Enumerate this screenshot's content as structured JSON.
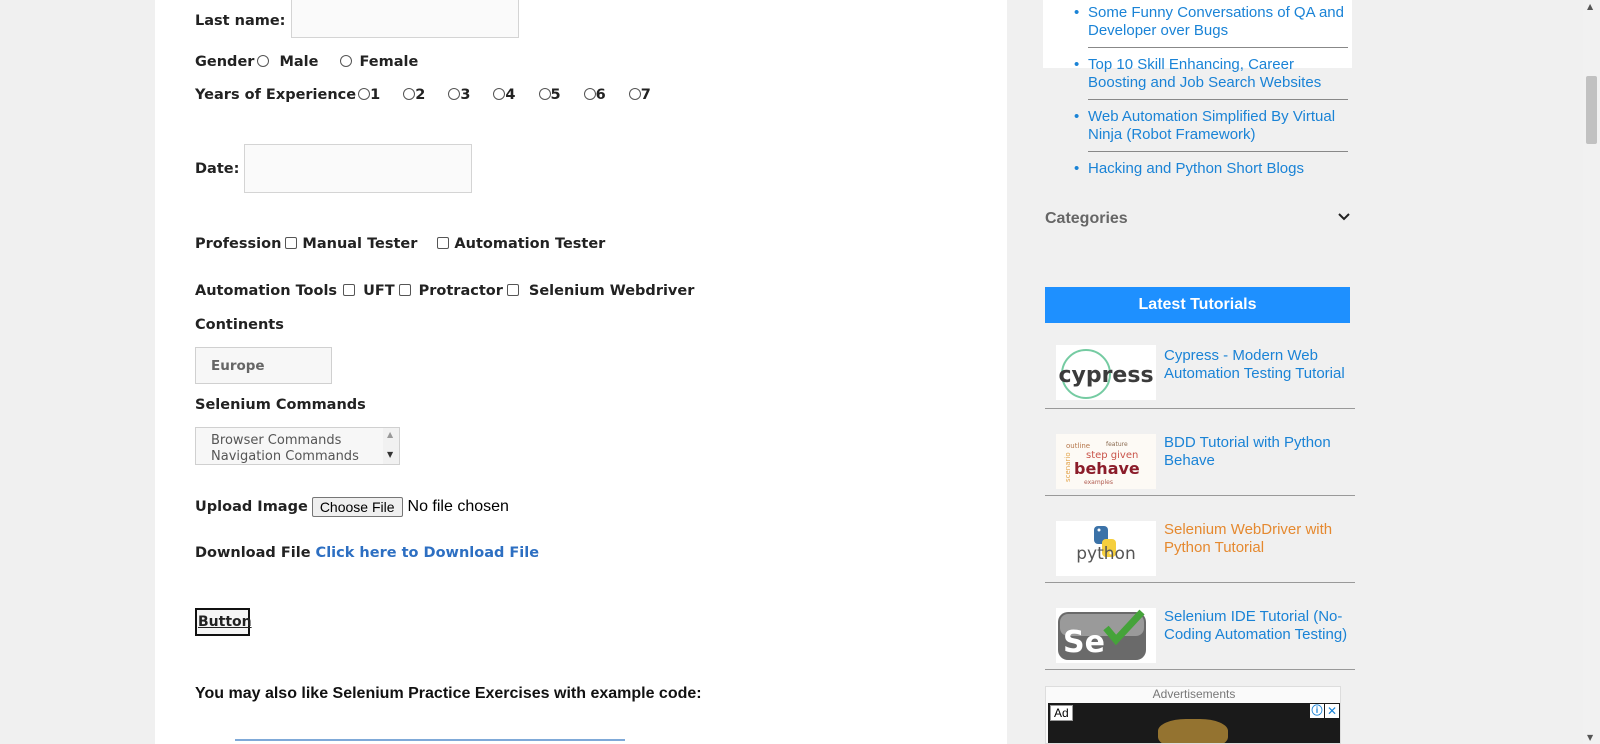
{
  "form": {
    "last_name_label": "Last name:",
    "gender_label": "Gender",
    "gender_options": [
      "Male",
      "Female"
    ],
    "experience_label": "Years of Experience",
    "experience_options": [
      "1",
      "2",
      "3",
      "4",
      "5",
      "6",
      "7"
    ],
    "date_label": "Date:",
    "profession_label": "Profession",
    "profession_options": [
      "Manual Tester",
      "Automation Tester"
    ],
    "tools_label": "Automation Tools",
    "tools_options": [
      "UFT",
      "Protractor",
      "Selenium Webdriver"
    ],
    "continents_label": "Continents",
    "continents_selected": "Europe",
    "commands_label": "Selenium Commands",
    "commands_options": [
      "Browser Commands",
      "Navigation Commands"
    ],
    "upload_label": "Upload Image",
    "choose_file_label": "Choose File",
    "no_file_text": "No file chosen",
    "download_label": "Download File",
    "download_link": "Click here to Download File",
    "button_label": "Button",
    "also_like": "You may also like Selenium Practice Exercises with example code:"
  },
  "sidebar": {
    "recent_posts": [
      "Some Funny Conversations of QA and Developer over Bugs",
      "Top 10 Skill Enhancing, Career Boosting and Job Search Websites",
      "Web Automation Simplified By Virtual Ninja (Robot Framework)",
      "Hacking and Python Short Blogs"
    ],
    "categories_label": "Categories",
    "latest_tutorials_label": "Latest Tutorials",
    "tutorials": [
      {
        "title": "Cypress - Modern Web Automation Testing Tutorial",
        "thumb": "cypress",
        "color": "#1a83d6"
      },
      {
        "title": "BDD Tutorial with Python Behave",
        "thumb": "behave",
        "color": "#1a83d6"
      },
      {
        "title": "Selenium WebDriver with Python Tutorial",
        "thumb": "python",
        "color": "#e5892f"
      },
      {
        "title": "Selenium IDE Tutorial (No-Coding Automation Testing)",
        "thumb": "Se",
        "color": "#1a83d6"
      }
    ],
    "advertisements_label": "Advertisements",
    "ad_badge": "Ad"
  },
  "colors": {
    "link": "#1a83d6",
    "download_link": "#2d6fc2",
    "banner": "#1e90ff",
    "hover_link": "#e5892f"
  }
}
